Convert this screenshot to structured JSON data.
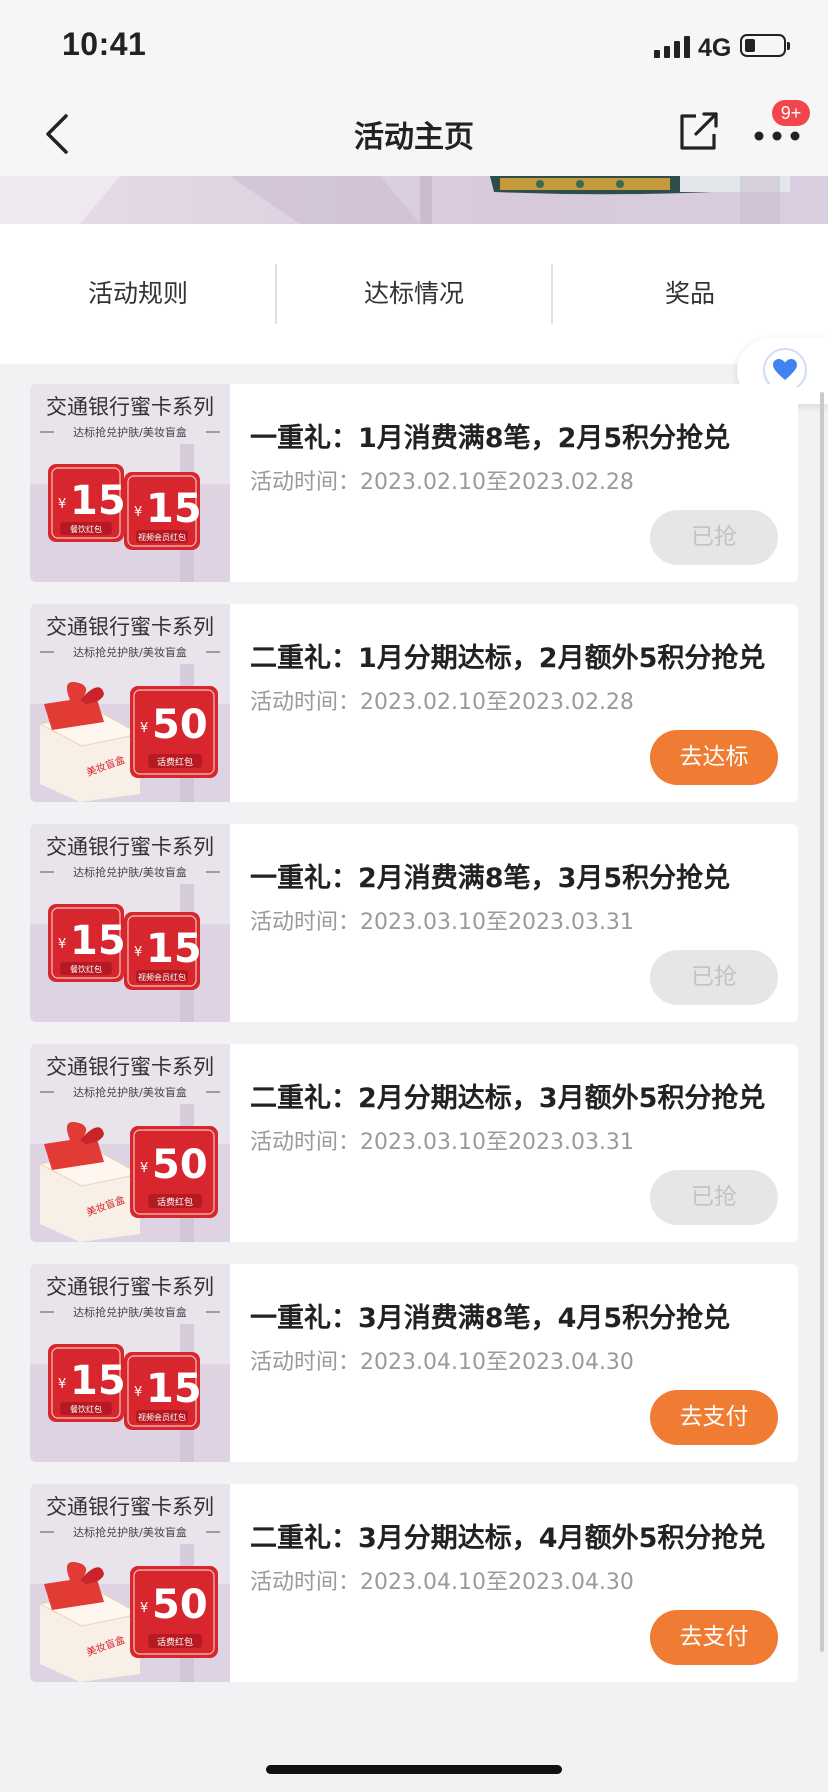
{
  "status_bar": {
    "time": "10:41",
    "network": "4G"
  },
  "nav": {
    "title": "活动主页",
    "badge": "9+"
  },
  "tabs": [
    "活动规则",
    "达标情况",
    "奖品"
  ],
  "thumbnails": {
    "series_title": "交通银行蜜卡系列",
    "series_subtitle": "达标抢兑护肤/美妆盲盒",
    "red_packet_value": "15",
    "currency": "¥",
    "packet_dining": "餐饮红包",
    "packet_video": "视频会员红包",
    "gift_value": "50",
    "gift_box_text": "美妆盲盒",
    "packet_phone": "话费红包"
  },
  "activities": [
    {
      "title": "一重礼：1月消费满8笔，2月5积分抢兑",
      "time": "活动时间：2023.02.10至2023.02.28",
      "button": "已抢",
      "state": "disabled",
      "thumb": "packets"
    },
    {
      "title": "二重礼：1月分期达标，2月额外5积分抢兑",
      "time": "活动时间：2023.02.10至2023.02.28",
      "button": "去达标",
      "state": "active",
      "thumb": "gift"
    },
    {
      "title": "一重礼：2月消费满8笔，3月5积分抢兑",
      "time": "活动时间：2023.03.10至2023.03.31",
      "button": "已抢",
      "state": "disabled",
      "thumb": "packets"
    },
    {
      "title": "二重礼：2月分期达标，3月额外5积分抢兑",
      "time": "活动时间：2023.03.10至2023.03.31",
      "button": "已抢",
      "state": "disabled",
      "thumb": "gift"
    },
    {
      "title": "一重礼：3月消费满8笔，4月5积分抢兑",
      "time": "活动时间：2023.04.10至2023.04.30",
      "button": "去支付",
      "state": "active",
      "thumb": "packets"
    },
    {
      "title": "二重礼：3月分期达标，4月额外5积分抢兑",
      "time": "活动时间：2023.04.10至2023.04.30",
      "button": "去支付",
      "state": "active",
      "thumb": "gift"
    }
  ],
  "colors": {
    "accent": "#f07b33",
    "badge": "#f2464c",
    "disabled_bg": "#e6e6e6",
    "heart": "#3f82f0",
    "red_packet": "#d8262e"
  }
}
